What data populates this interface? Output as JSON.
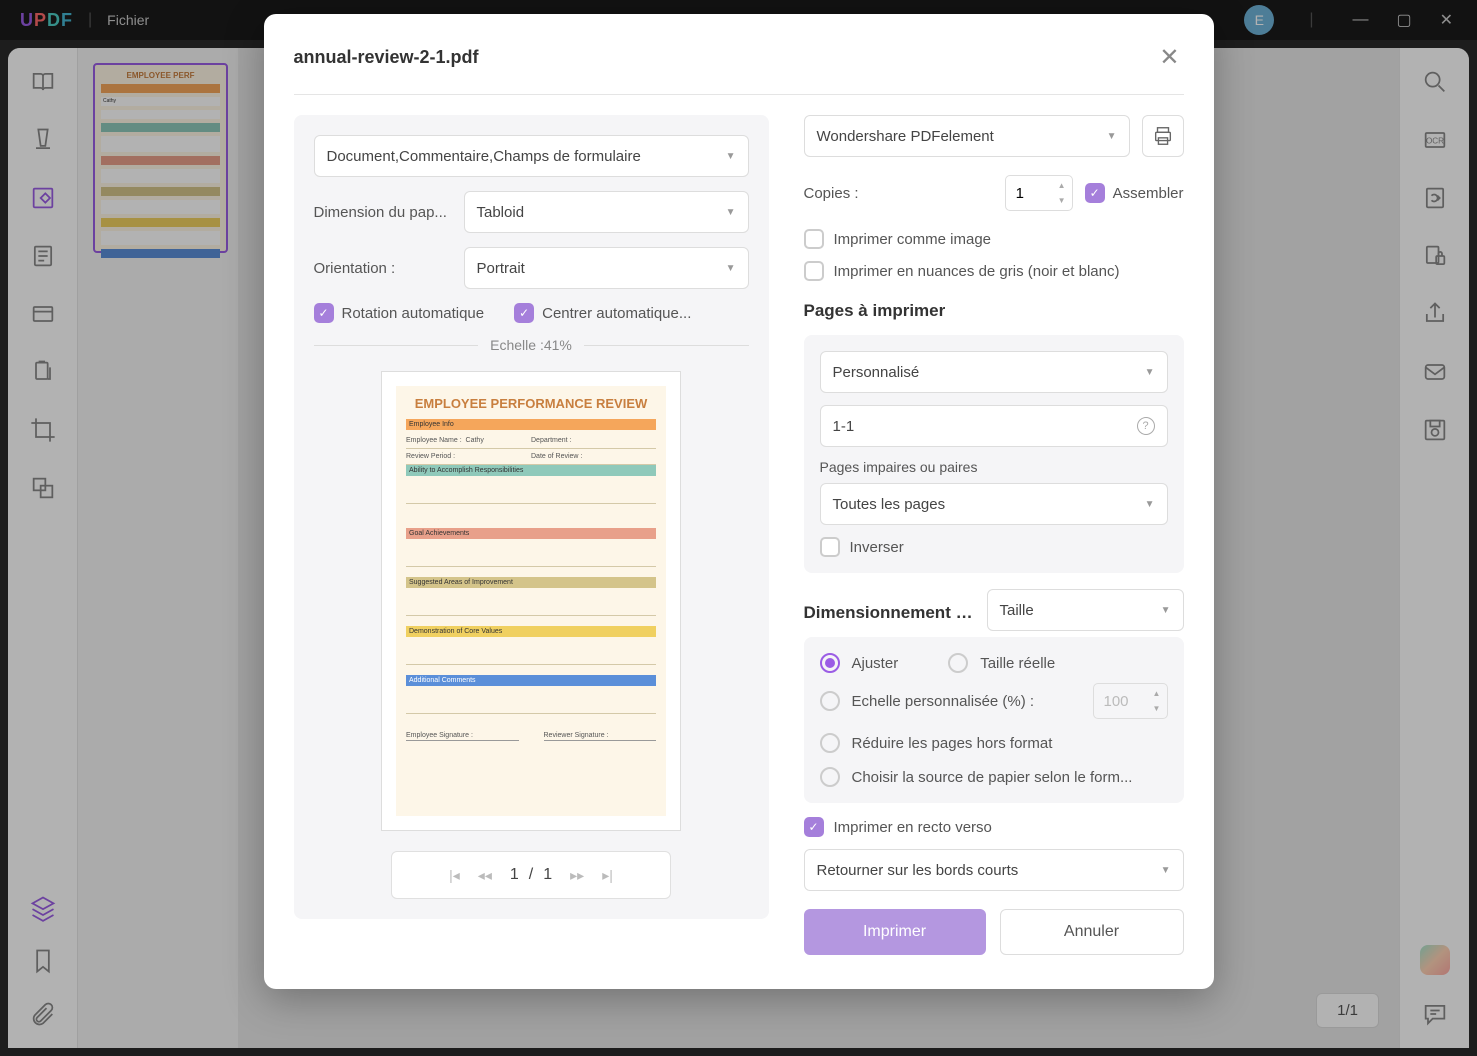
{
  "app": {
    "name": "UPDF",
    "menu_file": "Fichier",
    "avatar_letter": "E",
    "page_counter": "1/1"
  },
  "modal": {
    "title": "annual-review-2-1.pdf",
    "content_select": "Document,Commentaire,Champs de formulaire",
    "paper_label": "Dimension du pap...",
    "paper_value": "Tabloid",
    "orientation_label": "Orientation :",
    "orientation_value": "Portrait",
    "auto_rotate": "Rotation automatique",
    "auto_center": "Centrer automatique...",
    "scale_text": "Echelle :41%",
    "pager": {
      "current": "1",
      "sep": "/",
      "total": "1"
    },
    "printer": "Wondershare PDFelement",
    "copies_label": "Copies :",
    "copies_value": "1",
    "collate": "Assembler",
    "print_as_image": "Imprimer comme image",
    "print_grayscale": "Imprimer en nuances de gris (noir et blanc)",
    "pages_heading": "Pages à imprimer",
    "pages_mode": "Personnalisé",
    "pages_range": "1-1",
    "odd_even_label": "Pages impaires ou paires",
    "odd_even_value": "Toutes les pages",
    "reverse": "Inverser",
    "sizing_heading": "Dimensionnement et gestio...",
    "sizing_select": "Taille",
    "fit": "Ajuster",
    "actual": "Taille réelle",
    "custom_scale": "Echelle personnalisée (%) :",
    "custom_scale_value": "100",
    "shrink": "Réduire les pages hors format",
    "choose_source": "Choisir la source de papier selon le form...",
    "duplex": "Imprimer en recto verso",
    "flip": "Retourner sur les bords courts",
    "print_btn": "Imprimer",
    "cancel_btn": "Annuler"
  },
  "preview": {
    "title": "EMPLOYEE PERFORMANCE REVIEW",
    "sections": {
      "info": "Employee Info",
      "name_lbl": "Employee Name :",
      "name_val": "Cathy",
      "dept_lbl": "Department :",
      "period_lbl": "Review Period :",
      "date_lbl": "Date of Review :",
      "ability": "Ability to Accomplish Responsibilities",
      "goal": "Goal Achievements",
      "improve": "Suggested Areas of Improvement",
      "core": "Demonstration of Core Values",
      "comments": "Additional Comments",
      "emp_sig": "Employee Signature :",
      "rev_sig": "Reviewer Signature :"
    }
  }
}
